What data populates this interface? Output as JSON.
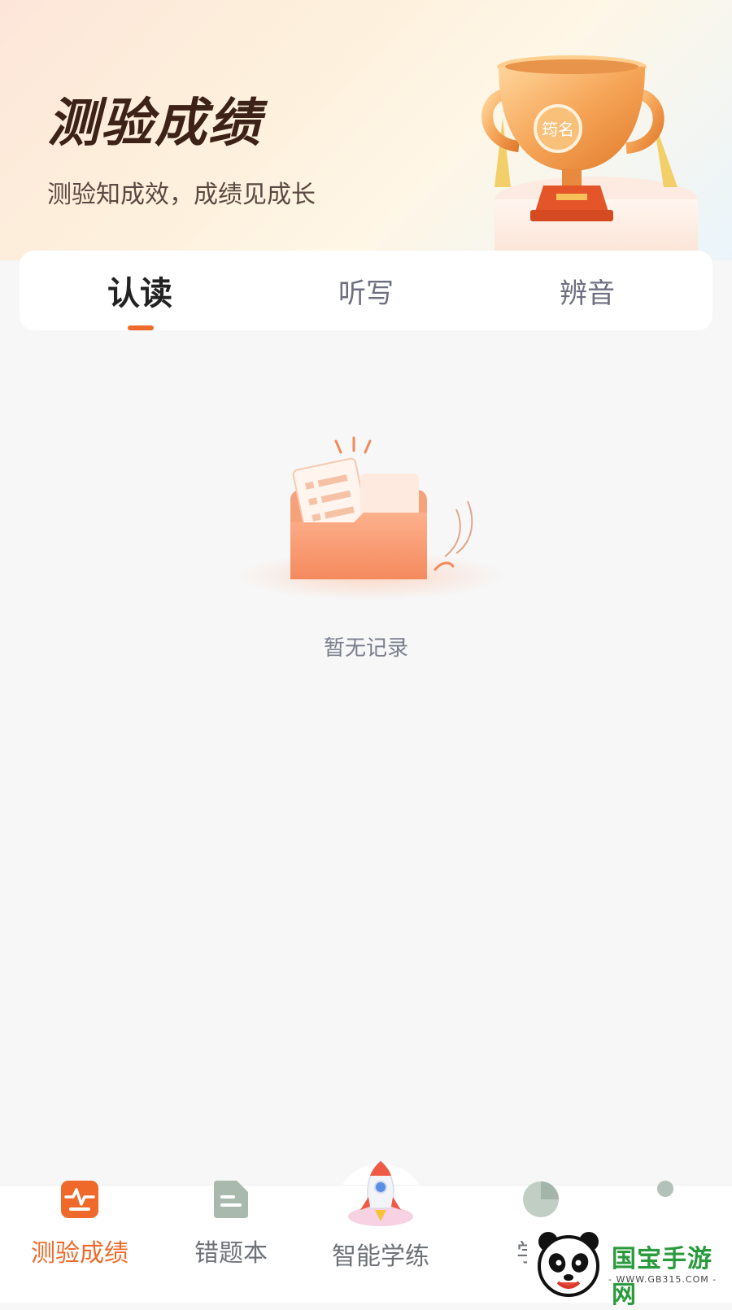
{
  "header": {
    "title": "测验成绩",
    "subtitle": "测验知成效，成绩见成长",
    "trophy_badge_text": "筠名"
  },
  "tabs": [
    {
      "label": "认读",
      "active": true
    },
    {
      "label": "听写",
      "active": false
    },
    {
      "label": "辨音",
      "active": false
    }
  ],
  "empty_state": {
    "icon": "empty-folder-icon",
    "text": "暂无记录"
  },
  "bottom_nav": [
    {
      "label": "测验成绩",
      "icon": "test-score-icon",
      "active": true
    },
    {
      "label": "错题本",
      "icon": "mistake-book-icon",
      "active": false
    },
    {
      "label": "智能学练",
      "icon": "rocket-icon",
      "active": false
    },
    {
      "label": "学习",
      "icon": "pie-chart-icon",
      "active": false
    },
    {
      "label": "",
      "icon": "profile-icon",
      "active": false
    }
  ],
  "watermark": {
    "text": "国宝手游网",
    "url": "- WWW.GB315.COM -"
  },
  "colors": {
    "accent": "#ef6a2a",
    "title": "#3d2217",
    "tab_inactive": "#6d6f80",
    "background": "#f7f7f7"
  }
}
